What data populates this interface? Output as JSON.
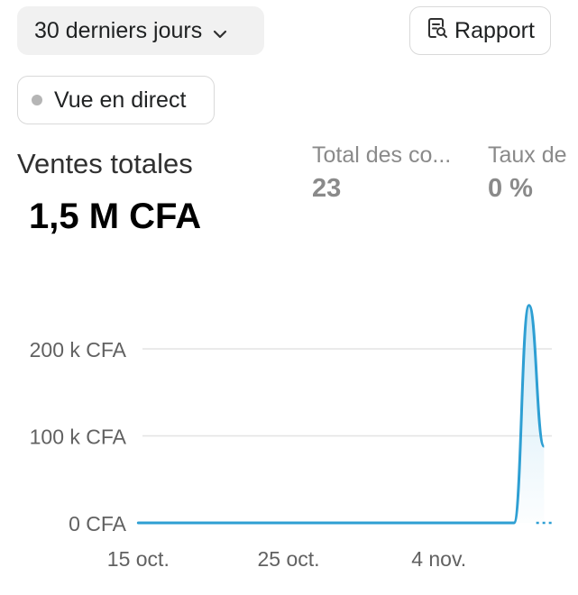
{
  "toolbar": {
    "period_label": "30 derniers jours",
    "period_icon": "chevron-down-icon",
    "report_label": "Rapport",
    "report_icon": "report-search-icon",
    "live_label": "Vue en direct",
    "live_icon": "status-dot-icon"
  },
  "metric": {
    "title": "Ventes totales",
    "value": "1,5 M CFA"
  },
  "kpis": [
    {
      "label": "Total des co...",
      "value": "23"
    },
    {
      "label": "Taux de",
      "value": "0 %"
    }
  ],
  "colors": {
    "line": "#2e9fd3",
    "fill_top": "#c7e6f5",
    "grid": "#e3e3e3",
    "axis_text": "#616161"
  },
  "chart_data": {
    "type": "area",
    "y_ticks": [
      {
        "value": 0,
        "label": "0 CFA"
      },
      {
        "value": 100000,
        "label": "100 k CFA"
      },
      {
        "value": 200000,
        "label": "200 k CFA"
      }
    ],
    "x_ticks": [
      {
        "date": "2023-10-15",
        "label": "15 oct."
      },
      {
        "date": "2023-10-25",
        "label": "25 oct."
      },
      {
        "date": "2023-11-04",
        "label": "4 nov."
      }
    ],
    "x_range": [
      "2023-10-13",
      "2023-11-12"
    ],
    "ylim": [
      0,
      200000
    ],
    "grid": true,
    "series": [
      {
        "points": [
          [
            "2023-10-13",
            0
          ],
          [
            "2023-10-15",
            0
          ],
          [
            "2023-10-20",
            0
          ],
          [
            "2023-10-25",
            0
          ],
          [
            "2023-10-30",
            0
          ],
          [
            "2023-11-04",
            0
          ],
          [
            "2023-11-09",
            0
          ],
          [
            "2023-11-10",
            250000
          ],
          [
            "2023-11-11",
            88000
          ]
        ]
      }
    ],
    "projection": [
      [
        "2023-11-10",
        0
      ],
      [
        "2023-11-12",
        0
      ]
    ]
  }
}
